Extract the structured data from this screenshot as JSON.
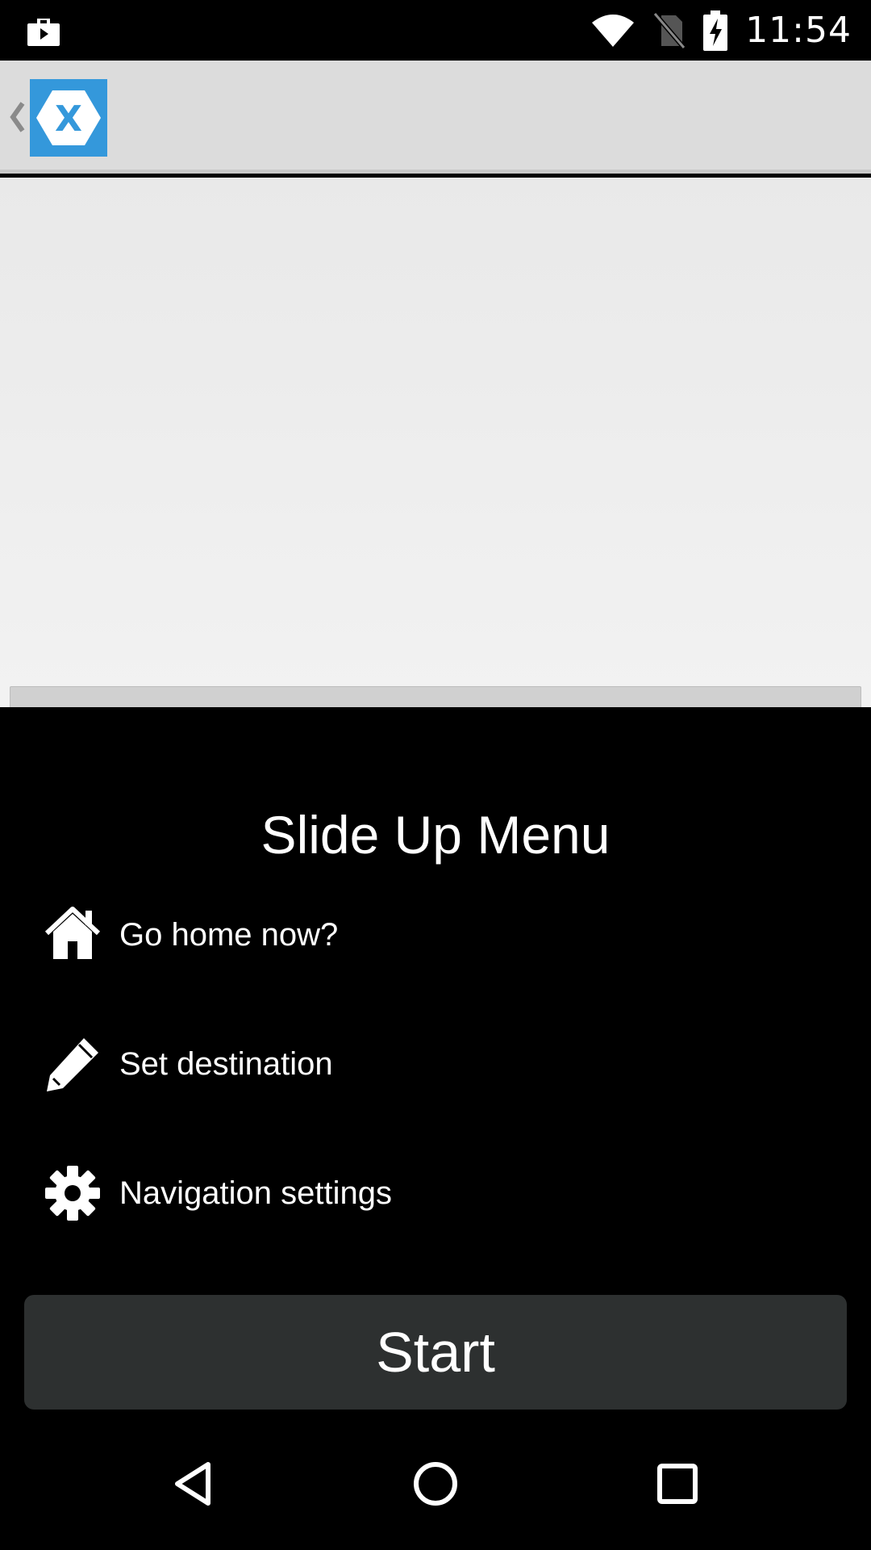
{
  "status_bar": {
    "time": "11:54",
    "icons": [
      "media-app-icon",
      "wifi-icon",
      "no-sim-icon",
      "battery-charging-icon"
    ]
  },
  "action_bar": {
    "back_icon": "chevron-left-icon",
    "logo_letter": "X",
    "logo_color": "#3498db"
  },
  "menu": {
    "title": "Slide Up Menu",
    "items": [
      {
        "label": "Go home now?",
        "icon": "home-icon"
      },
      {
        "label": "Set destination",
        "icon": "pencil-icon"
      },
      {
        "label": "Navigation settings",
        "icon": "gear-icon"
      }
    ],
    "start_label": "Start"
  },
  "nav_bar": {
    "buttons": [
      "back-icon",
      "home-circle-icon",
      "recents-icon"
    ]
  }
}
